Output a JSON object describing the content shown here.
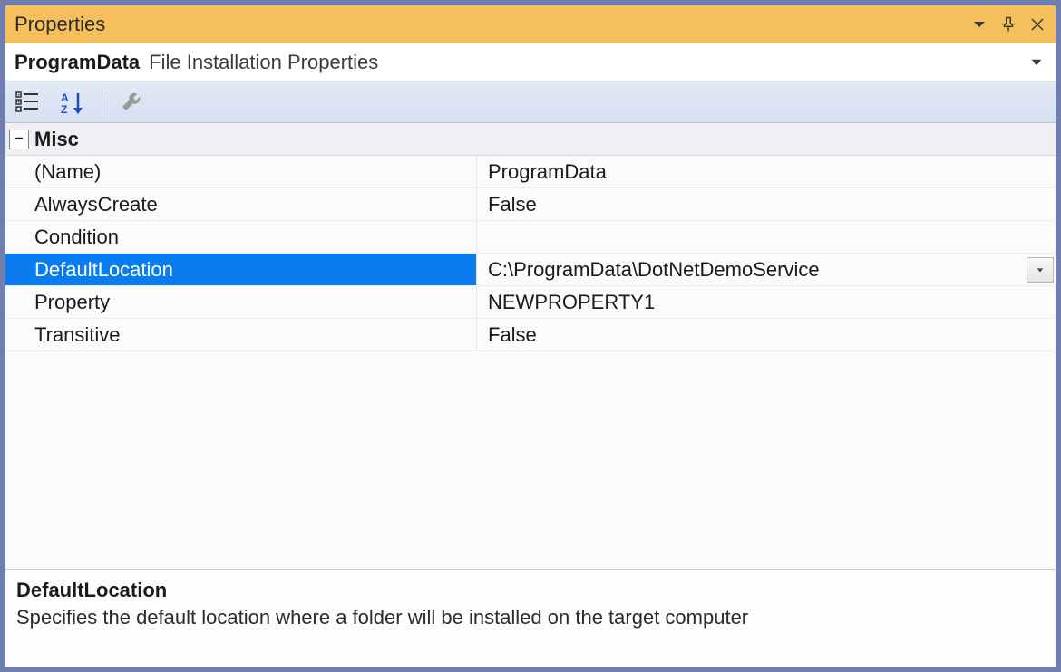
{
  "window": {
    "title": "Properties"
  },
  "object": {
    "name": "ProgramData",
    "type": "File Installation Properties"
  },
  "toolbar": {
    "categorized_tooltip": "Categorized",
    "alphabetical_tooltip": "Alphabetical",
    "property_pages_tooltip": "Property Pages"
  },
  "category": {
    "label": "Misc",
    "expanded": true
  },
  "rows": [
    {
      "label": "(Name)",
      "value": "ProgramData",
      "selected": false,
      "has_dropdown": false
    },
    {
      "label": "AlwaysCreate",
      "value": "False",
      "selected": false,
      "has_dropdown": false
    },
    {
      "label": "Condition",
      "value": "",
      "selected": false,
      "has_dropdown": false
    },
    {
      "label": "DefaultLocation",
      "value": "C:\\ProgramData\\DotNetDemoService",
      "selected": true,
      "has_dropdown": true
    },
    {
      "label": "Property",
      "value": "NEWPROPERTY1",
      "selected": false,
      "has_dropdown": false
    },
    {
      "label": "Transitive",
      "value": "False",
      "selected": false,
      "has_dropdown": false
    }
  ],
  "description": {
    "name": "DefaultLocation",
    "text": "Specifies the default location where a folder will be installed on the target computer"
  }
}
